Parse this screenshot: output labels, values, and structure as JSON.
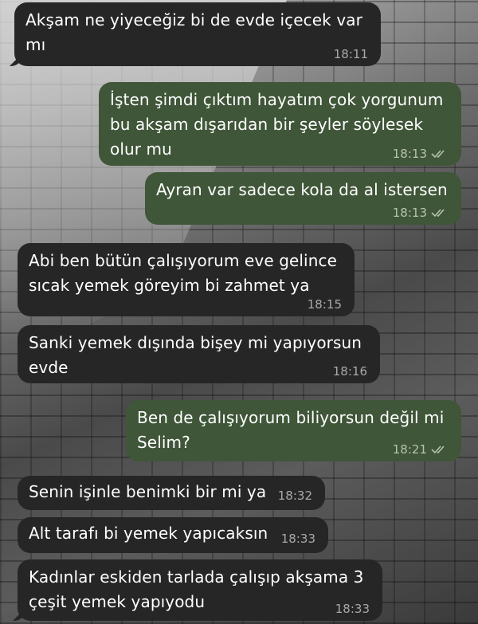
{
  "messages": [
    {
      "dir": "in",
      "text": "Akşam ne yiyeceğiz bi de evde içecek var\nmı",
      "time": "18:11"
    },
    {
      "dir": "out",
      "text": "İşten şimdi çıktım hayatım çok yorgunum\nbu akşam dışarıdan bir şeyler söylesek\nolur mu",
      "time": "18:13",
      "status": "read"
    },
    {
      "dir": "out",
      "text": "Ayran var sadece kola da al istersen",
      "time": "18:13",
      "status": "read"
    },
    {
      "dir": "in",
      "text": "Abi ben bütün çalışıyorum eve gelince\nsıcak yemek göreyim bi zahmet ya",
      "time": "18:15"
    },
    {
      "dir": "in",
      "text": "Sanki yemek dışında bişey mi yapıyorsun\nevde",
      "time": "18:16"
    },
    {
      "dir": "out",
      "text": "Ben de çalışıyorum biliyorsun değil mi\nSelim?",
      "time": "18:21",
      "status": "read"
    },
    {
      "dir": "in",
      "text": "Senin işinle benimki bir mi ya",
      "time": "18:32"
    },
    {
      "dir": "in",
      "text": "Alt tarafı bi yemek yapıcaksın",
      "time": "18:33"
    },
    {
      "dir": "in",
      "text": "Kadınlar eskiden tarlada çalışıp akşama 3\nçeşit yemek yapıyodu",
      "time": "18:33"
    }
  ],
  "colors": {
    "incoming_bubble": "#262626",
    "outgoing_bubble": "#3f5638",
    "text": "#ffffff",
    "timestamp": "#a9a9a9"
  },
  "icons": {
    "read_receipt": "double-check-icon"
  }
}
